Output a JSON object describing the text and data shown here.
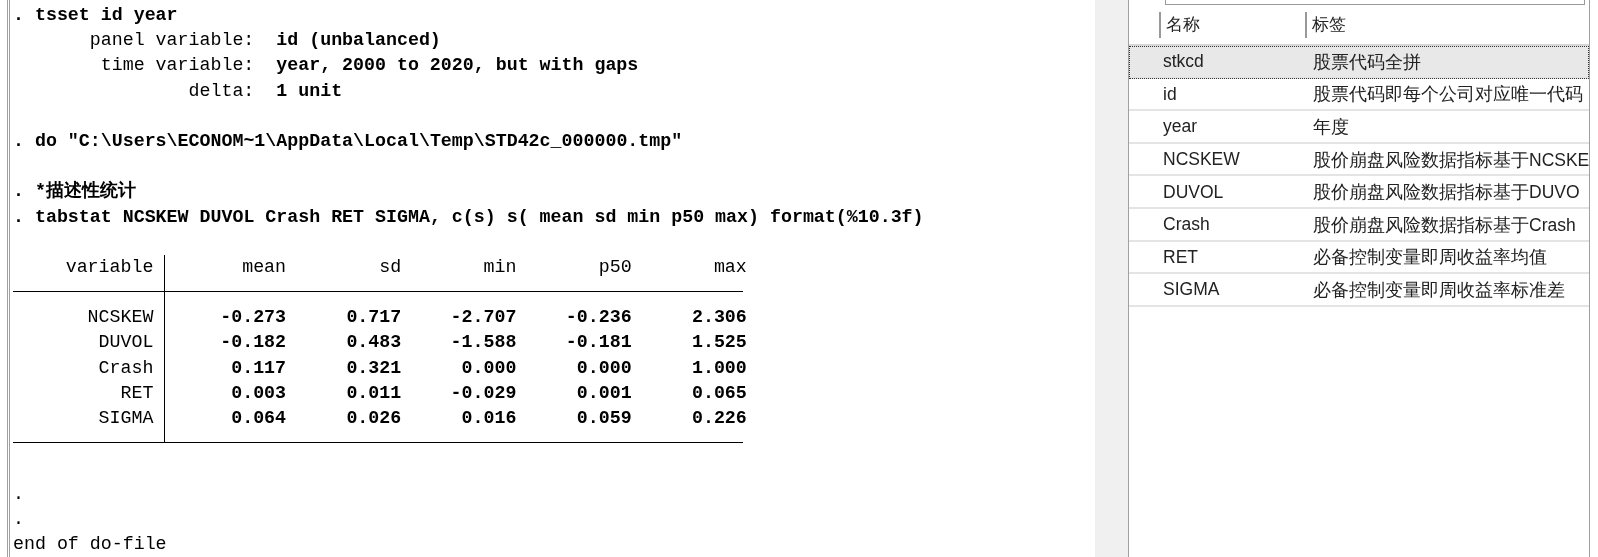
{
  "results": {
    "log_before": [
      {
        "kind": "command",
        "text": ". tsset id year"
      },
      {
        "kind": "setting",
        "label": "panel variable:",
        "value": "id (unbalanced)"
      },
      {
        "kind": "setting",
        "label": "time variable:",
        "value": "year, 2000 to 2020, but with gaps"
      },
      {
        "kind": "setting",
        "label": "delta:",
        "value": "1 unit"
      },
      {
        "kind": "blank"
      },
      {
        "kind": "command",
        "text": ". do \"C:\\Users\\ECONOM~1\\AppData\\Local\\Temp\\STD42c_000000.tmp\""
      },
      {
        "kind": "blank"
      },
      {
        "kind": "command",
        "text": ". *描述性统计"
      },
      {
        "kind": "command",
        "text": ". tabstat NCSKEW DUVOL Crash RET SIGMA, c(s) s( mean sd min p50 max) format(%10.3f)"
      },
      {
        "kind": "blank"
      }
    ],
    "table": {
      "columns": [
        "variable",
        "mean",
        "sd",
        "min",
        "p50",
        "max"
      ],
      "rows": [
        {
          "variable": "NCSKEW",
          "values": [
            "-0.273",
            "0.717",
            "-2.707",
            "-0.236",
            "2.306"
          ]
        },
        {
          "variable": "DUVOL",
          "values": [
            "-0.182",
            "0.483",
            "-1.588",
            "-0.181",
            "1.525"
          ]
        },
        {
          "variable": "Crash",
          "values": [
            "0.117",
            "0.321",
            "0.000",
            "0.000",
            "1.000"
          ]
        },
        {
          "variable": "RET",
          "values": [
            "0.003",
            "0.011",
            "-0.029",
            "0.001",
            "0.065"
          ]
        },
        {
          "variable": "SIGMA",
          "values": [
            "0.064",
            "0.026",
            "0.016",
            "0.059",
            "0.226"
          ]
        }
      ]
    },
    "log_after": [
      {
        "kind": "blank"
      },
      {
        "kind": "text",
        "text": "."
      },
      {
        "kind": "text",
        "text": "."
      },
      {
        "kind": "text",
        "text": "end of do-file"
      }
    ]
  },
  "variables": {
    "columns": [
      "名称",
      "标签"
    ],
    "rows": [
      {
        "name": "stkcd",
        "label": "股票代码全拼",
        "selected": true
      },
      {
        "name": "id",
        "label": "股票代码即每个公司对应唯一代码",
        "selected": false
      },
      {
        "name": "year",
        "label": "年度",
        "selected": false
      },
      {
        "name": "NCSKEW",
        "label": "股价崩盘风险数据指标基于NCSKE",
        "selected": false
      },
      {
        "name": "DUVOL",
        "label": "股价崩盘风险数据指标基于DUVO",
        "selected": false
      },
      {
        "name": "Crash",
        "label": "股价崩盘风险数据指标基于Crash",
        "selected": false
      },
      {
        "name": "RET",
        "label": "必备控制变量即周收益率均值",
        "selected": false
      },
      {
        "name": "SIGMA",
        "label": "必备控制变量即周收益率标准差",
        "selected": false
      }
    ]
  }
}
